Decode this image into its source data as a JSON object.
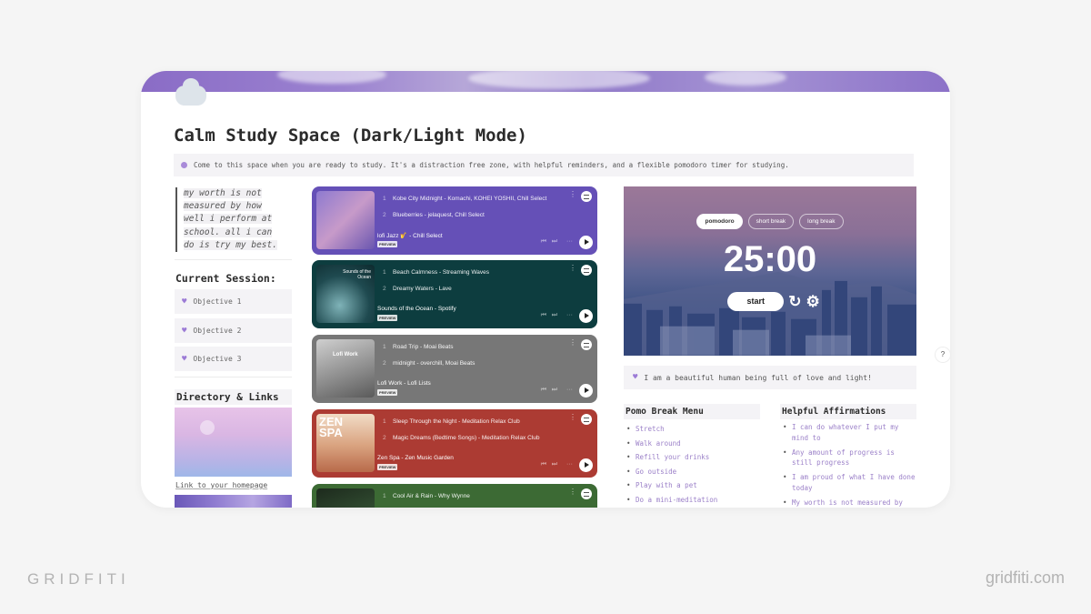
{
  "page": {
    "title": "Calm Study Space (Dark/Light Mode)",
    "page_icon": "cloud-icon",
    "intro_callout": "Come to this space when you are ready to study. It's a distraction free zone, with helpful reminders, and a flexible pomodoro timer for studying."
  },
  "left": {
    "quote_lines": [
      "my worth is not",
      "measured by how",
      "well i perform at",
      "school. all i can",
      "do is try my best."
    ],
    "session_heading": "Current Session:",
    "objectives": [
      "Objective 1",
      "Objective 2",
      "Objective 3"
    ],
    "directory_heading": "Directory & Links",
    "homepage_link": "Link to your homepage"
  },
  "playlists": [
    {
      "color": "#6550b7",
      "tracks": [
        {
          "n": "1",
          "title": "Kobe City Midnight - Komachi, KOHEI YOSHII, Chill Select"
        },
        {
          "n": "2",
          "title": "Blueberries - jelaquest, Chill Select"
        }
      ],
      "name": "lofi Jazz 🎷 - Chill Select",
      "badge": "PREVIEW"
    },
    {
      "color": "#0d3d3f",
      "tracks": [
        {
          "n": "1",
          "title": "Beach Calmness - Streaming Waves"
        },
        {
          "n": "2",
          "title": "Dreamy Waters - Lave"
        }
      ],
      "name": "Sounds of the Ocean - Spotify",
      "badge": "PREVIEW",
      "art_text": "Sounds of the Ocean"
    },
    {
      "color": "#777777",
      "tracks": [
        {
          "n": "1",
          "title": "Road Trip - Moai Beats"
        },
        {
          "n": "2",
          "title": "midnight - overchill, Moai Beats"
        }
      ],
      "name": "Lofi Work - Lofi Lists",
      "badge": "PREVIEW",
      "art_text": "Lofi Work"
    },
    {
      "color": "#ac3b33",
      "tracks": [
        {
          "n": "1",
          "title": "Sleep Through the Night - Meditation Relax Club"
        },
        {
          "n": "2",
          "title": "Magic Dreams (Bedtime Songs) - Meditation Relax Club"
        }
      ],
      "name": "Zen Spa - Zen Music Garden",
      "badge": "PREVIEW",
      "art_text": "ZEN SPA"
    },
    {
      "color": "#3c6a34",
      "tracks": [
        {
          "n": "1",
          "title": "Cool Air & Rain - Why Wynne"
        }
      ],
      "name": "",
      "badge": ""
    }
  ],
  "pomodoro": {
    "tabs": [
      "pomodoro",
      "short break",
      "long break"
    ],
    "active_tab": "pomodoro",
    "time": "25:00",
    "start_label": "start",
    "reset_icon": "↻",
    "settings_icon": "⚙"
  },
  "affirmation_callout": "I am a beautiful human being full of love and light!",
  "break_menu": {
    "heading": "Pomo Break Menu",
    "items": [
      "Stretch",
      "Walk around",
      "Refill your drinks",
      "Go outside",
      "Play with a pet",
      "Do a mini-meditation"
    ]
  },
  "affirmations": {
    "heading": "Helpful Affirmations",
    "items": [
      "I can do whatever I put my mind to",
      "Any amount of progress is still progress",
      "I am proud of what I have done today",
      "My worth is not measured by"
    ]
  },
  "help_button": "?",
  "branding": {
    "left": "GRIDFITI",
    "right": "gridfiti.com"
  },
  "colors": {
    "accent": "#a98bd9",
    "callout_bg": "#f4f3f6",
    "list_text": "#9b80c8"
  }
}
